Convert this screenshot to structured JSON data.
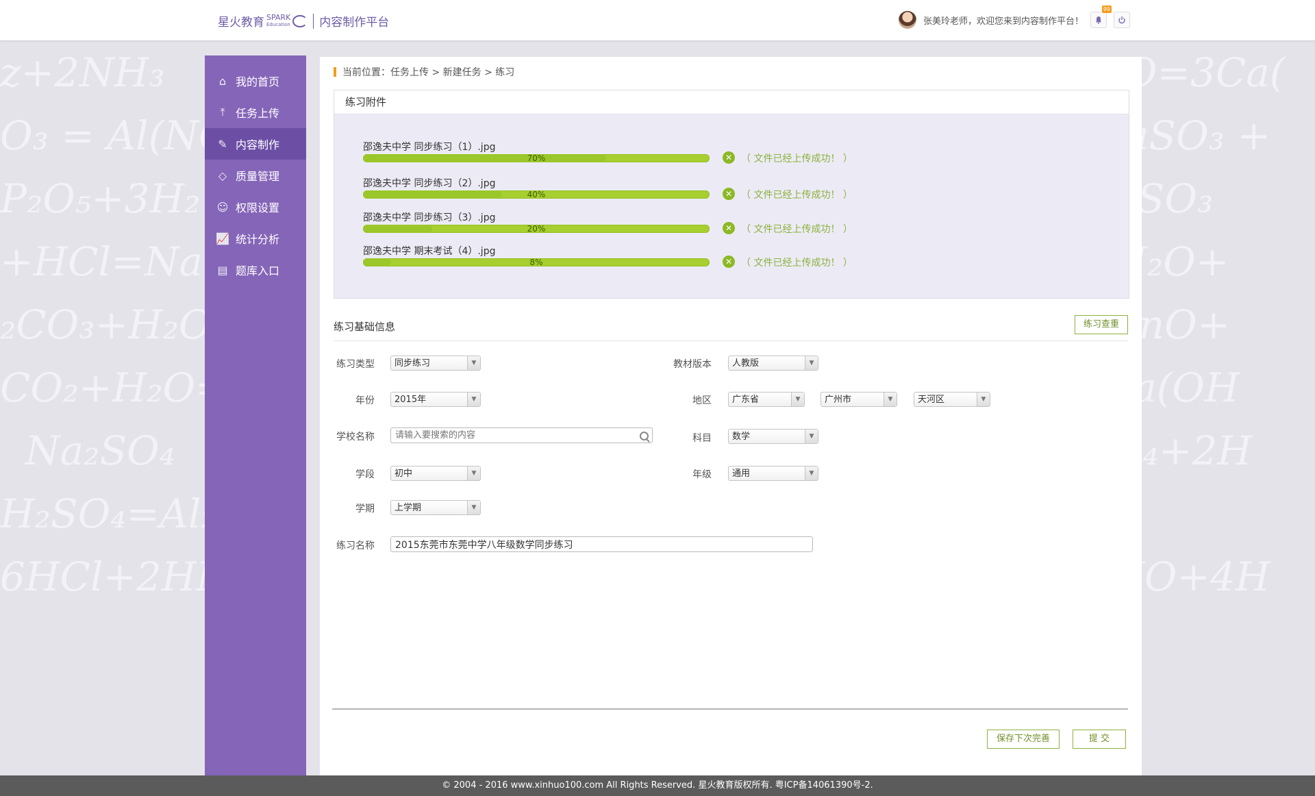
{
  "header": {
    "logo_main": "星火教育",
    "logo_spark": "SPARK",
    "logo_education": "Education",
    "platform": "内容制作平台",
    "welcome": "张美玲老师，欢迎您来到内容制作平台！",
    "notification_count": "99"
  },
  "sidebar": {
    "items": [
      {
        "label": "我的首页",
        "icon": "home-icon"
      },
      {
        "label": "任务上传",
        "icon": "upload-icon"
      },
      {
        "label": "内容制作",
        "icon": "brush-icon",
        "active": true
      },
      {
        "label": "质量管理",
        "icon": "diamond-icon"
      },
      {
        "label": "权限设置",
        "icon": "user-icon"
      },
      {
        "label": "统计分析",
        "icon": "chart-icon"
      },
      {
        "label": "题库入口",
        "icon": "book-icon"
      }
    ]
  },
  "breadcrumb": "当前位置：任务上传 > 新建任务 > 练习",
  "attachments": {
    "title": "练习附件",
    "files": [
      {
        "name": "邵逸夫中学 同步练习（1）.jpg",
        "progress": "70%",
        "status": "（ 文件已经上传成功！ ）"
      },
      {
        "name": "邵逸夫中学 同步练习（2）.jpg",
        "progress": "40%",
        "status": "（ 文件已经上传成功！ ）"
      },
      {
        "name": "邵逸夫中学 同步练习（3）.jpg",
        "progress": "20%",
        "status": "（ 文件已经上传成功！ ）"
      },
      {
        "name": "邵逸夫中学 期末考试（4）.jpg",
        "progress": "8%",
        "status": "（ 文件已经上传成功！ ）"
      }
    ]
  },
  "form": {
    "title": "练习基础信息",
    "reset_label": "练习查重",
    "type_label": "练习类型",
    "type_value": "同步练习",
    "edition_label": "教材版本",
    "edition_value": "人教版",
    "year_label": "年份",
    "year_value": "2015年",
    "region_label": "地区",
    "province_value": "广东省",
    "city_value": "广州市",
    "district_value": "天河区",
    "school_label": "学校名称",
    "school_placeholder": "请输入要搜索的内容",
    "subject_label": "科目",
    "subject_value": "数学",
    "stage_label": "学段",
    "stage_value": "初中",
    "grade_label": "年级",
    "grade_value": "通用",
    "term_label": "学期",
    "term_value": "上学期",
    "name_label": "练习名称",
    "name_value": "2015东莞市东莞中学八年级数学同步练习"
  },
  "actions": {
    "save_label": "保存下次完善",
    "submit_label": "提  交"
  },
  "footer": "© 2004 - 2016 www.xinhuo100.com All Rights Reserved. 星火教育版权所有. 粤ICP备14061390号-2.",
  "colors": {
    "sidebar": "#8565b8",
    "sidebar_active": "#6c4fa5",
    "progress": "#a6cf2f",
    "accent_orange": "#f39c1e",
    "success_text": "#8cb13c"
  }
}
